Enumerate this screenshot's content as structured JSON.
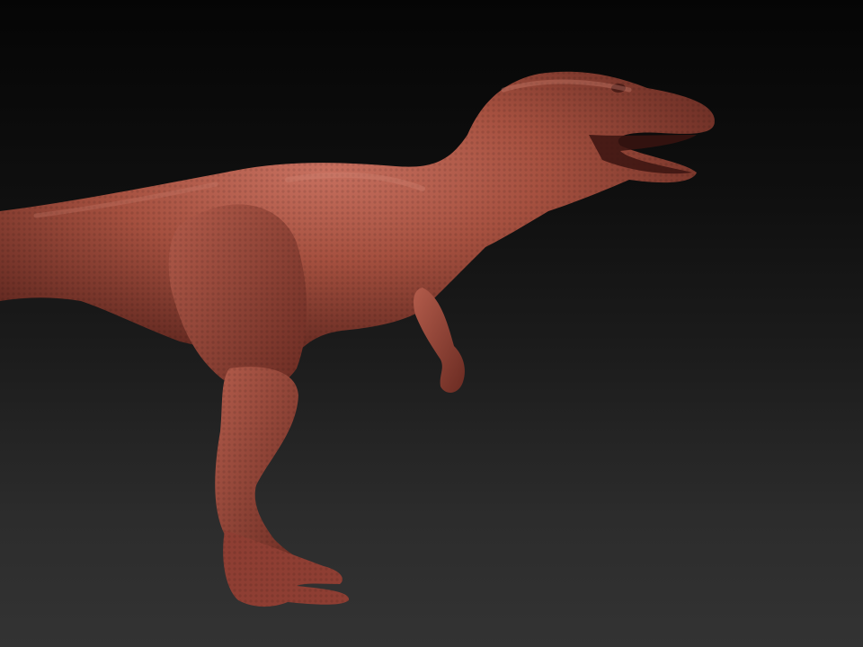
{
  "scene": {
    "subject": "dinosaur-sculpt",
    "colors": {
      "background_top": "#050505",
      "background_bottom": "#333333",
      "model_base": "#9c4a40",
      "model_highlight": "#c26a5c",
      "model_shadow": "#5e2620"
    }
  }
}
